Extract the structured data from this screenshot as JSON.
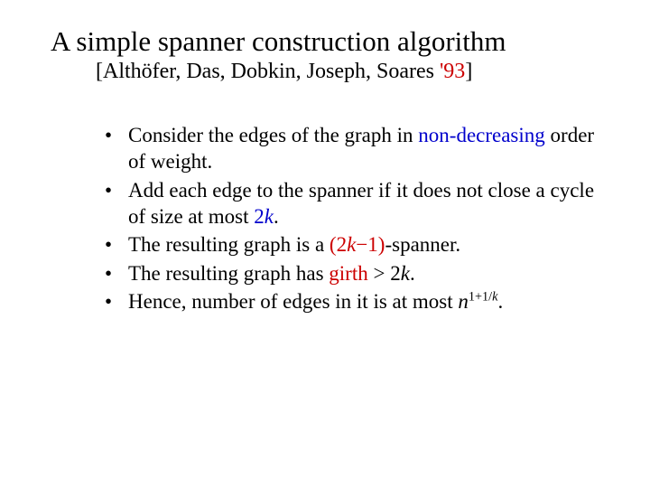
{
  "title": "A simple spanner construction algorithm",
  "subtitle_open": "[Althöfer, Das, Dobkin, Joseph, Soares ",
  "subtitle_year": "'93",
  "subtitle_close": "]",
  "b1a": "Consider the edges of the graph in ",
  "b1b": "non-decreasing",
  "b1c": " order of weight.",
  "b2a": "Add each edge to the spanner if it does not close a cycle of size at most ",
  "b2b_2": "2",
  "b2b_k": "k",
  "b2c": ".",
  "b3a": "The resulting graph is a ",
  "b3b_open": "(2",
  "b3b_k": "k",
  "b3b_minus": "−1)",
  "b3c": "-spanner.",
  "b4a": "The resulting graph has ",
  "b4b": "girth ",
  "b4c_gt": " > 2",
  "b4c_k": "k",
  "b4d": ".",
  "b5a": "Hence, number of edges in it is at most ",
  "b5_n": "n",
  "b5_exp_a": "1+1/",
  "b5_exp_k": "k",
  "b5c": "."
}
